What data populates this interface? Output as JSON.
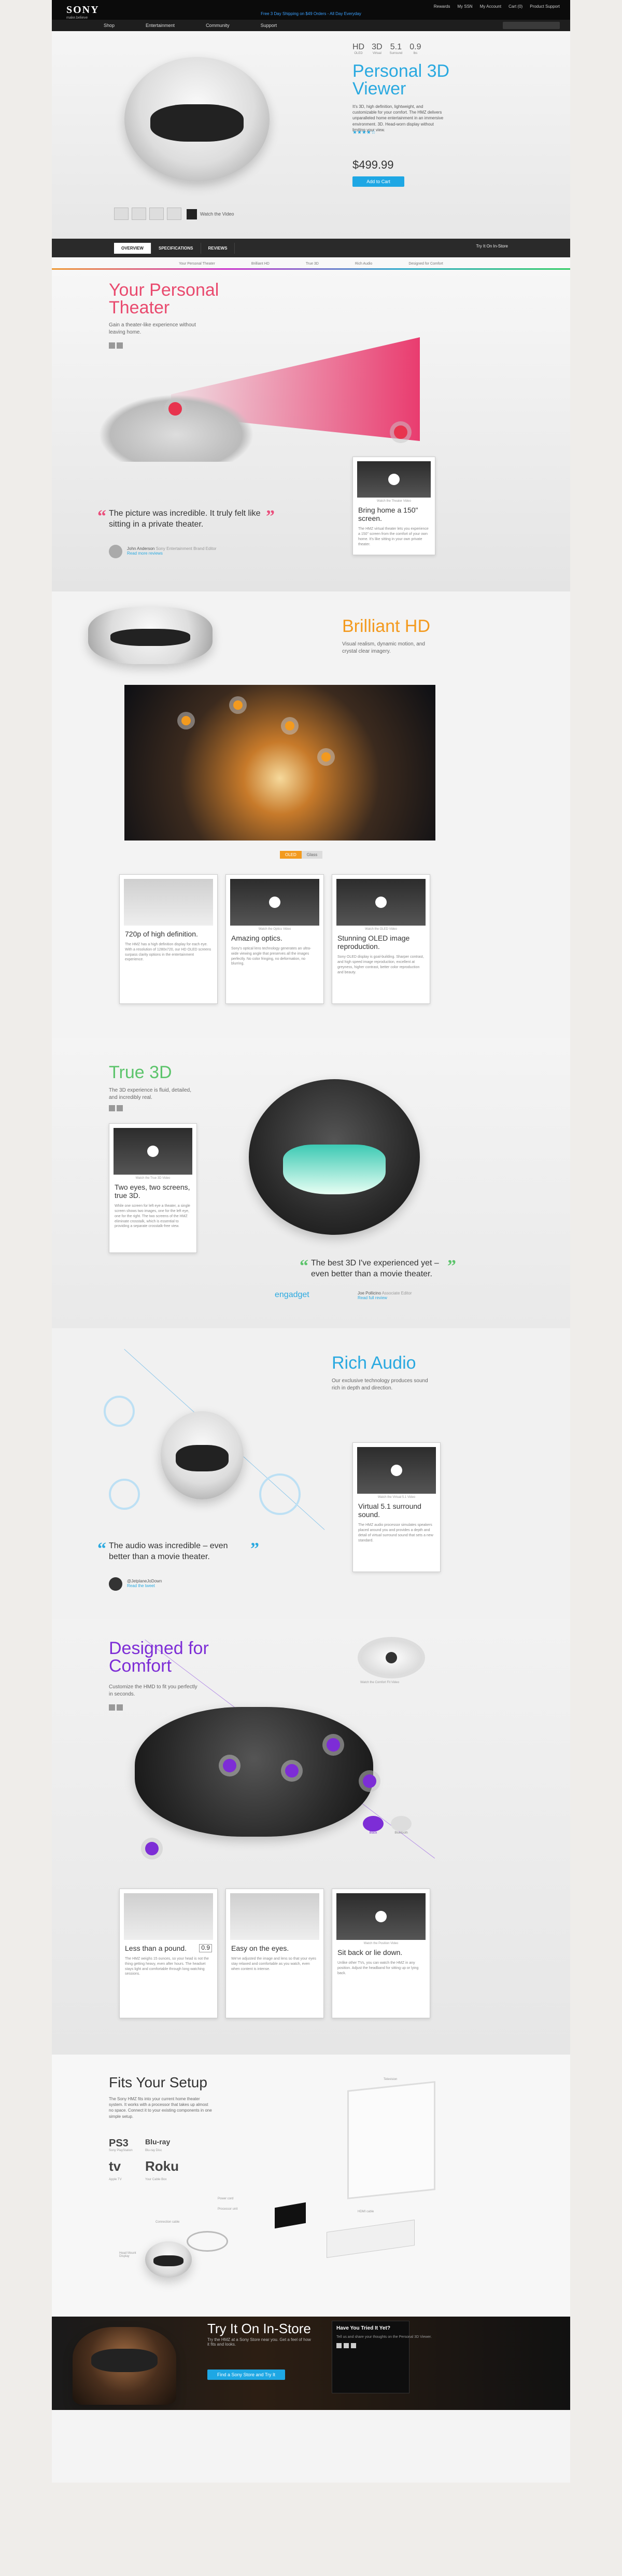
{
  "topbar": {
    "brand": "SONY",
    "tagline": "make.believe",
    "links": [
      "Rewards",
      "My SSN",
      "My Account",
      "Cart (0)",
      "Product Support"
    ],
    "promo": "Free 3 Day Shipping on $49 Orders - All Day Everyday",
    "nav": [
      "Shop",
      "Entertainment",
      "Community",
      "Support"
    ]
  },
  "hero": {
    "specs": [
      {
        "big": "HD",
        "small": "OLED"
      },
      {
        "big": "3D",
        "small": "Virtual"
      },
      {
        "big": "5.1",
        "small": "Surround"
      },
      {
        "big": "0.9",
        "small": "lbs"
      }
    ],
    "title": "Personal 3D Viewer",
    "desc": "It's 3D, high definition, lightweight, and customizable for your comfort. The HMZ delivers unparalleled home entertainment in an immersive environment. 3D. Head-worn display without limiting your view.",
    "more": "Read more >",
    "stars": "★★★★☆",
    "price": "$499.99",
    "cart": "Add to Cart",
    "watch": "Watch the Video"
  },
  "tabs": {
    "items": [
      "OVERVIEW",
      "SPECIFICATIONS",
      "REVIEWS"
    ],
    "try": "Try It On In-Store",
    "sub": [
      "Your Personal Theater",
      "Brilliant HD",
      "True 3D",
      "Rich Audio",
      "Designed for Comfort"
    ]
  },
  "theater": {
    "title": "Your Personal Theater",
    "desc": "Gain a theater-like experience without leaving home.",
    "card_cap": "Watch the Theater Video",
    "card_title": "Bring home a 150\" screen.",
    "card_body": "The HMZ virtual theater lets you experience a 150\" screen from the comfort of your own home. It's like sitting in your own private theater.",
    "quote": "The picture was incredible. It truly felt like sitting in a private theater.",
    "author": "John Anderson",
    "author_role": "Sony Entertainment Brand Editor",
    "author_link": "Read more reviews"
  },
  "hd": {
    "title": "Brilliant HD",
    "desc": "Visual realism, dynamic motion, and crystal clear imagery.",
    "toggle": [
      "OLED",
      "Glass"
    ],
    "cards": [
      {
        "cap": "",
        "title": "720p of high definition.",
        "body": "The HMZ has a high definition display for each eye. With a resolution of 1280x720, our HD OLED screens surpass clarity options in the entertainment experience."
      },
      {
        "cap": "Watch the Optics Video",
        "title": "Amazing optics.",
        "body": "Sony's optical lens technology generates an ultra-wide viewing angle that preserves all the images perfectly. No color fringing, no deformation, no blurring."
      },
      {
        "cap": "Watch the OLED Video",
        "title": "Stunning OLED image reproduction.",
        "body": "Sony OLED display is goal-building. Sharper contrast, and high speed image reproduction, excellent at greyness, higher contrast, better color reproduction and beauty."
      }
    ]
  },
  "true3d": {
    "title": "True 3D",
    "desc": "The 3D experience is fluid, detailed, and incredibly real.",
    "card_cap": "Watch the True 3D Video",
    "card_title": "Two eyes, two screens, true 3D.",
    "card_body": "While one screen for left eye a theater, a single screen shows two images, one for the left eye, one for the right. The two screens of the HMZ eliminate crosstalk, which is essential to providing a separate crosstalk-free view.",
    "quote": "The best 3D I've experienced yet – even better than a movie theater.",
    "source": "engadget",
    "author": "Joe Pollicino",
    "author_role": "Associate Editor",
    "author_link": "Read full review"
  },
  "audio": {
    "title": "Rich Audio",
    "desc": "Our exclusive technology produces sound rich in depth and direction.",
    "card_cap": "Watch the Virtual 5.1 Video",
    "card_title": "Virtual 5.1 surround sound.",
    "card_body": "The HMZ audio processor simulates speakers placed around you and provides a depth and detail of virtual surround sound that sets a new standard.",
    "quote": "The audio was incredible – even better than a movie theater.",
    "author": "@JetplaneJoDown",
    "author_link": "Read the tweet"
  },
  "comfort": {
    "title": "Designed for Comfort",
    "desc": "Customize the HMD to fit you perfectly in seconds.",
    "card_cap": "Watch the Comfort Fit Video",
    "toggle": [
      "Black",
      "Bluetooth"
    ],
    "cards": [
      {
        "cap": "",
        "title": "Less than a pound.",
        "badge": "0.9",
        "body": "The HMZ weighs 15 ounces, so your head is not the thing getting heavy, even after hours. The headset stays light and comfortable through long watching sessions."
      },
      {
        "cap": "",
        "title": "Easy on the eyes.",
        "body": "We've adjusted the image and lens so that your eyes stay relaxed and comfortable as you watch, even when content is intense."
      },
      {
        "cap": "Watch the Position Video",
        "title": "Sit back or lie down.",
        "body": "Unlike other TVs, you can watch the HMZ in any position. Adjust the headband for sitting up or lying back."
      }
    ]
  },
  "setup": {
    "title": "Fits Your Setup",
    "desc": "The Sony HMZ fits into your current home theater system. It works with a processor that takes up almost no space. Connect it to your existing components in one simple setup.",
    "logos": [
      "PS3",
      "tv",
      "Roku",
      "Blu-ray"
    ],
    "logo_caps": [
      "Sony PlayStation",
      "Apple TV",
      "Your Cable Box",
      "Blu-ray Disc"
    ],
    "labels": [
      "Television",
      "Processor unit",
      "Power cord",
      "Connection cable",
      "HDMI cable",
      "Head Mount Display"
    ]
  },
  "instore": {
    "title": "Try It On In-Store",
    "desc": "Try the HMZ at a Sony Store near you. Get a feel of how it fits and looks.",
    "btn": "Find a Sony Store and Try It",
    "fb_title": "Have You Tried It Yet?",
    "fb_body": "Tell us and share your thoughts on the Personal 3D Viewer."
  },
  "colors": {
    "accent": "#1ea7e4",
    "pink": "#e93c6f",
    "orange": "#f39a1e",
    "green": "#5cc46b",
    "purple": "#7d2dd6"
  }
}
